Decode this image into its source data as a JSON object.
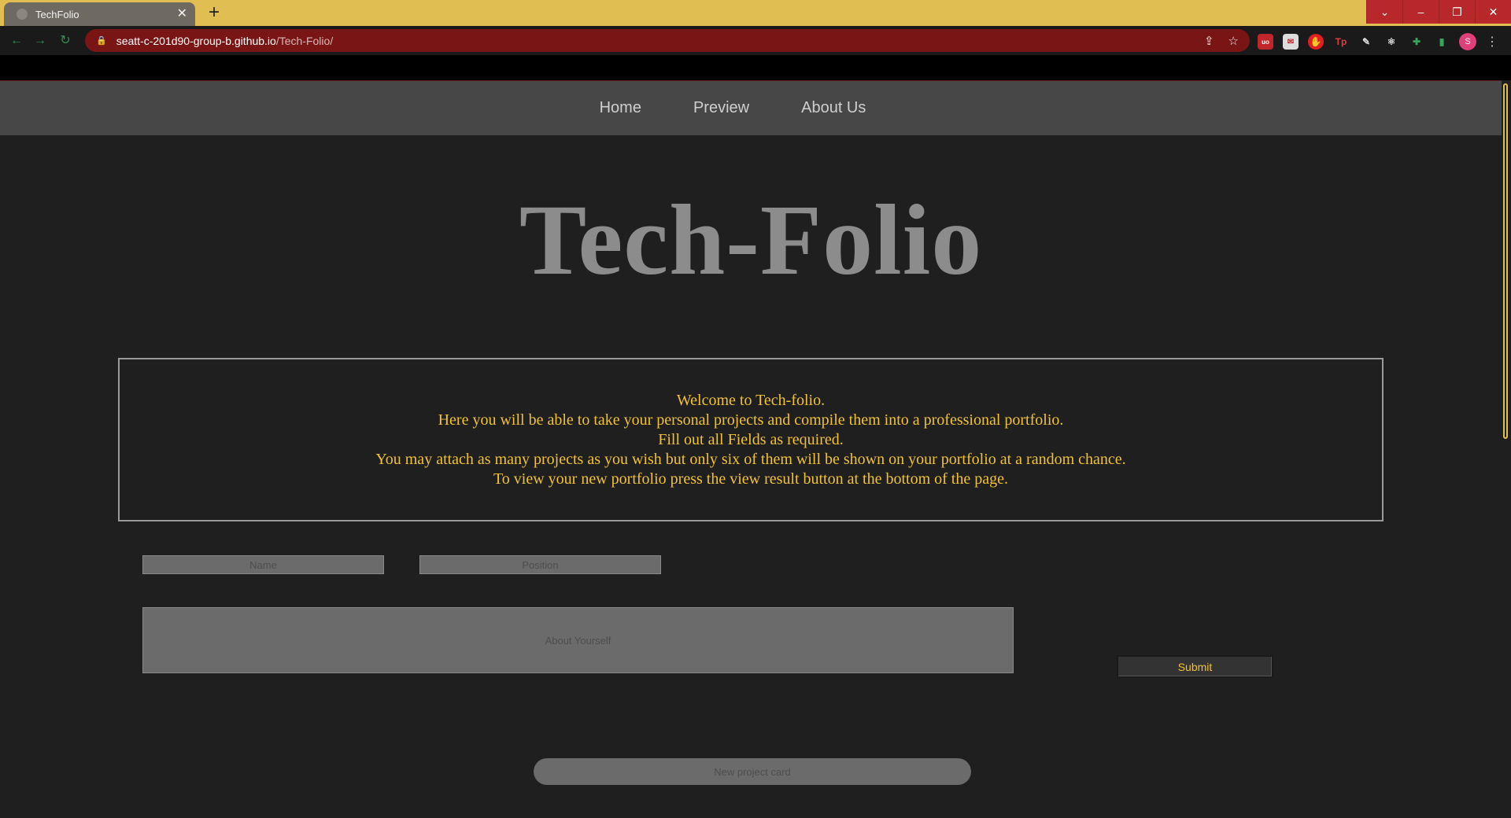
{
  "browser": {
    "tab_title": "TechFolio",
    "tab_close": "✕",
    "new_tab": "+",
    "url_host": "seatt-c-201d90-group-b.github.io",
    "url_path": "/Tech-Folio/",
    "window_controls": {
      "dropdown": "⌄",
      "minimize": "–",
      "restore": "❐",
      "close": "✕"
    },
    "avatar_initial": "S",
    "accent_color": "#e1be52",
    "omnibox_color": "#7a1515"
  },
  "nav": {
    "items": [
      {
        "label": "Home"
      },
      {
        "label": "Preview"
      },
      {
        "label": "About Us"
      }
    ]
  },
  "hero": {
    "title": "Tech-Folio"
  },
  "welcome": {
    "lines": [
      "Welcome to Tech-folio.",
      "Here you will be able to take your personal projects and compile them into a professional portfolio.",
      "Fill out all Fields as required.",
      "You may attach as many projects as you wish but only six of them will be shown on your portfolio at a random chance.",
      "To view your new portfolio press the view result button at the bottom of the page."
    ],
    "text_color": "#f1c232"
  },
  "form": {
    "name_placeholder": "Name",
    "position_placeholder": "Position",
    "about_placeholder": "About Yourself",
    "submit_label": "Submit",
    "new_card_label": "New project card"
  }
}
